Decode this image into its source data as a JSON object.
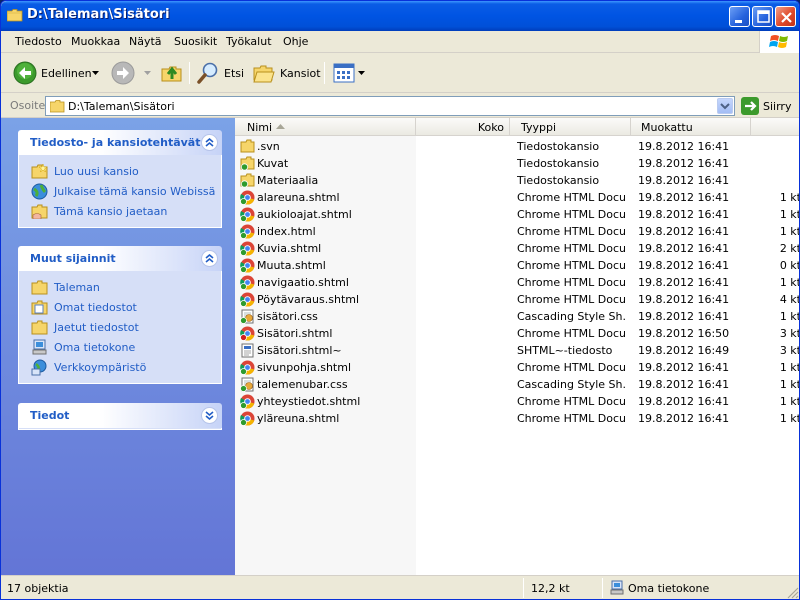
{
  "window": {
    "title": "D:\\Taleman\\Sisätori"
  },
  "menu": [
    "Tiedosto",
    "Muokkaa",
    "Näytä",
    "Suosikit",
    "Työkalut",
    "Ohje"
  ],
  "toolbar": {
    "back_label": "Edellinen",
    "search_label": "Etsi",
    "folders_label": "Kansiot"
  },
  "address": {
    "label": "Osoite",
    "value": "D:\\Taleman\\Sisätori",
    "go_label": "Siirry"
  },
  "tasks_panel": {
    "title": "Tiedosto- ja kansiotehtävät",
    "items": [
      {
        "label": "Luo uusi kansio",
        "icon": "new-folder-icon"
      },
      {
        "label": "Julkaise tämä kansio Webissä",
        "icon": "publish-web-icon"
      },
      {
        "label": "Tämä kansio jaetaan",
        "icon": "share-folder-icon"
      }
    ]
  },
  "places_panel": {
    "title": "Muut sijainnit",
    "items": [
      {
        "label": "Taleman",
        "icon": "folder-icon"
      },
      {
        "label": "Omat tiedostot",
        "icon": "my-documents-icon"
      },
      {
        "label": "Jaetut tiedostot",
        "icon": "folder-icon"
      },
      {
        "label": "Oma tietokone",
        "icon": "my-computer-icon"
      },
      {
        "label": "Verkkoympäristö",
        "icon": "network-icon"
      }
    ]
  },
  "details_panel": {
    "title": "Tiedot"
  },
  "columns": {
    "name": "Nimi",
    "size": "Koko",
    "type": "Tyyppi",
    "modified": "Muokattu"
  },
  "files": [
    {
      "name": ".svn",
      "size": "",
      "type": "Tiedostokansio",
      "modified": "19.8.2012 16:41",
      "icon": "folder"
    },
    {
      "name": "Kuvat",
      "size": "",
      "type": "Tiedostokansio",
      "modified": "19.8.2012 16:41",
      "icon": "folder-svn"
    },
    {
      "name": "Materiaalia",
      "size": "",
      "type": "Tiedostokansio",
      "modified": "19.8.2012 16:41",
      "icon": "folder-svn"
    },
    {
      "name": "alareuna.shtml",
      "size": "1 kt",
      "type": "Chrome HTML Docu...",
      "modified": "19.8.2012 16:41",
      "icon": "chrome"
    },
    {
      "name": "aukioloajat.shtml",
      "size": "1 kt",
      "type": "Chrome HTML Docu...",
      "modified": "19.8.2012 16:41",
      "icon": "chrome"
    },
    {
      "name": "index.html",
      "size": "1 kt",
      "type": "Chrome HTML Docu...",
      "modified": "19.8.2012 16:41",
      "icon": "chrome"
    },
    {
      "name": "Kuvia.shtml",
      "size": "2 kt",
      "type": "Chrome HTML Docu...",
      "modified": "19.8.2012 16:41",
      "icon": "chrome"
    },
    {
      "name": "Muuta.shtml",
      "size": "0 kt",
      "type": "Chrome HTML Docu...",
      "modified": "19.8.2012 16:41",
      "icon": "chrome"
    },
    {
      "name": "navigaatio.shtml",
      "size": "1 kt",
      "type": "Chrome HTML Docu...",
      "modified": "19.8.2012 16:41",
      "icon": "chrome"
    },
    {
      "name": "Pöytävaraus.shtml",
      "size": "4 kt",
      "type": "Chrome HTML Docu...",
      "modified": "19.8.2012 16:41",
      "icon": "chrome"
    },
    {
      "name": "sisätori.css",
      "size": "1 kt",
      "type": "Cascading Style Sh...",
      "modified": "19.8.2012 16:41",
      "icon": "css"
    },
    {
      "name": "Sisätori.shtml",
      "size": "3 kt",
      "type": "Chrome HTML Docu...",
      "modified": "19.8.2012 16:50",
      "icon": "chrome-mod"
    },
    {
      "name": "Sisätori.shtml~",
      "size": "3 kt",
      "type": "SHTML~-tiedosto",
      "modified": "19.8.2012 16:49",
      "icon": "generic"
    },
    {
      "name": "sivunpohja.shtml",
      "size": "1 kt",
      "type": "Chrome HTML Docu...",
      "modified": "19.8.2012 16:41",
      "icon": "chrome"
    },
    {
      "name": "talemenubar.css",
      "size": "1 kt",
      "type": "Cascading Style Sh...",
      "modified": "19.8.2012 16:41",
      "icon": "css"
    },
    {
      "name": "yhteystiedot.shtml",
      "size": "1 kt",
      "type": "Chrome HTML Docu...",
      "modified": "19.8.2012 16:41",
      "icon": "chrome"
    },
    {
      "name": "yläreuna.shtml",
      "size": "1 kt",
      "type": "Chrome HTML Docu...",
      "modified": "19.8.2012 16:41",
      "icon": "chrome"
    }
  ],
  "status": {
    "count": "17 objektia",
    "size": "12,2 kt",
    "location": "Oma tietokone"
  }
}
